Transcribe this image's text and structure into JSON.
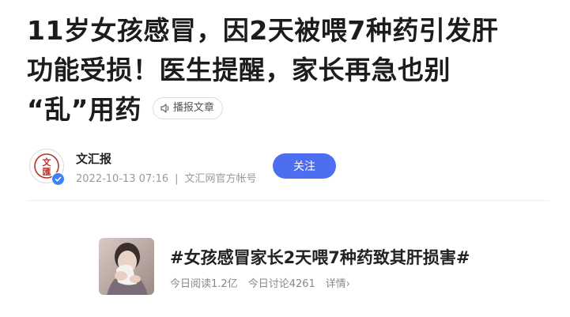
{
  "article": {
    "title_line1": "11岁女孩感冒，因2天被喂7种药引发肝",
    "title_line2": "功能受损！医生提醒，家长再急也别",
    "title_line3": "“乱”用药",
    "listen_label": "播报文章"
  },
  "author": {
    "name": "文汇报",
    "logo_text_top": "文",
    "logo_text_bottom": "匯",
    "date": "2022-10-13 07:16",
    "account_type": "文汇网官方帐号",
    "follow_label": "关注"
  },
  "topic": {
    "title": "#女孩感冒家长2天喂7种药致其肝损害#",
    "reads": "今日阅读1.2亿",
    "discussions": "今日讨论4261",
    "detail_label": "详情›"
  },
  "colors": {
    "accent": "#4e6ef2",
    "logo_red": "#b8302a",
    "verified": "#3b82f6"
  }
}
